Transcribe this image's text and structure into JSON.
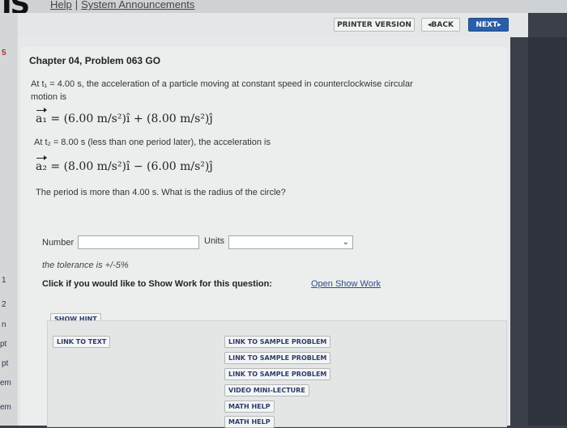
{
  "header": {
    "brand": "JS",
    "links": [
      "Help",
      "System Announcements"
    ],
    "separator": "|"
  },
  "nav": {
    "printer_label": "PRINTER VERSION",
    "back_label": "◂BACK",
    "next_label": "NEXT▸"
  },
  "left_strip": [
    "5",
    "1",
    "2",
    "n",
    "pt",
    "pt",
    "em",
    "em"
  ],
  "problem": {
    "title": "Chapter 04, Problem 063 GO",
    "intro_line1": "At t₁ = 4.00 s, the acceleration of a particle moving at constant speed in counterclockwise circular",
    "intro_line2": "motion is",
    "eq1_lhs": "a₁",
    "eq1_rhs": " = (6.00 m/s²)î + (8.00 m/s²)ĵ",
    "line2": "At t₂ = 8.00 s (less than one period later), the acceleration is",
    "eq2_lhs": "a₂",
    "eq2_rhs": " = (8.00 m/s²)î − (6.00 m/s²)ĵ",
    "question": "The period is more than 4.00 s. What is the radius of the circle?"
  },
  "answer": {
    "number_label": "Number",
    "number_value": "",
    "units_label": "Units",
    "units_value": "",
    "tolerance": "the tolerance is +/-5%",
    "show_work_text": "Click if you would like to Show Work for this question:",
    "show_work_link": "Open Show Work"
  },
  "resources": {
    "show_hint": "SHOW HINT",
    "link_to_text": "LINK TO TEXT",
    "sample1": "LINK TO SAMPLE PROBLEM",
    "sample2": "LINK TO SAMPLE PROBLEM",
    "sample3": "LINK TO SAMPLE PROBLEM",
    "video": "VIDEO MINI-LECTURE",
    "math1": "MATH HELP",
    "math2": "MATH HELP"
  }
}
